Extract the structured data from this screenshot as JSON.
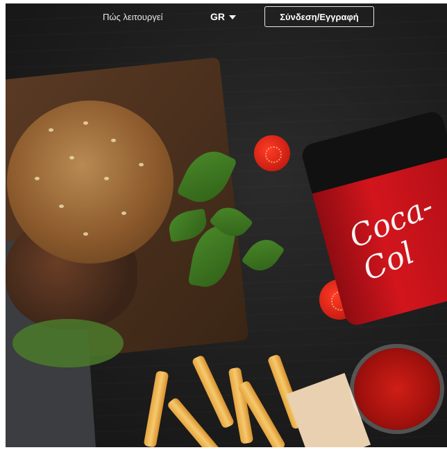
{
  "header": {
    "how_it_works": "Πώς λειτουργεί",
    "language": "GR",
    "login_signup": "Σύνδεση/Εγγραφή"
  },
  "illustration": {
    "can_text": "Coca-Col"
  },
  "colors": {
    "background": "#1d1d1d",
    "text": "#ffffff",
    "border": "#e6e6e6"
  }
}
